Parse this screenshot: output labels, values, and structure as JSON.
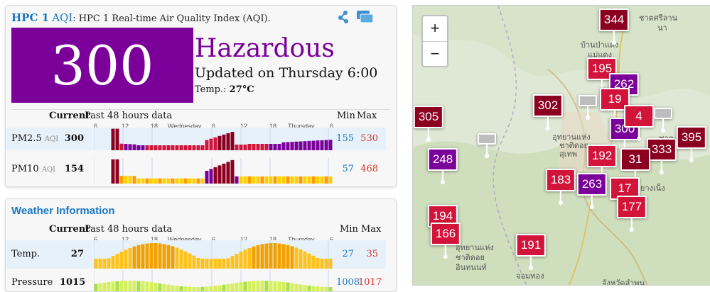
{
  "aqi_panel": {
    "station": "HPC 1",
    "aqi_label": "AQI",
    "subtitle": "HPC 1 Real-time Air Quality Index (AQI).",
    "aqi_value": "300",
    "level": "Hazardous",
    "updated": "Updated on Thursday 6:00",
    "temp_label": "Temp.:",
    "temp_value": "27°C",
    "colors": {
      "hazardous": "#7b0099",
      "very_unhealthy": "#8b0021",
      "unhealthy": "#d2143a",
      "moderate": "#ffd000",
      "sensitive": "#ff9a00"
    },
    "table": {
      "current_header": "Current",
      "history_header": "Past 48 hours data",
      "min_header": "Min",
      "max_header": "Max",
      "axis_ticks": [
        "6",
        "12",
        "18",
        "Wednesday",
        "6",
        "12",
        "18",
        "Thursday",
        "6"
      ],
      "rows": [
        {
          "name": "PM2.5",
          "unit": "AQI",
          "current": "300",
          "min": "155",
          "max": "530"
        },
        {
          "name": "PM10",
          "unit": "AQI",
          "current": "154",
          "min": "57",
          "max": "468"
        }
      ]
    }
  },
  "weather_panel": {
    "title": "Weather Information",
    "current_header": "Current",
    "history_header": "Past 48 hours data",
    "min_header": "Min",
    "max_header": "Max",
    "axis_ticks": [
      "6",
      "12",
      "18",
      "Wednesday",
      "6",
      "12",
      "18",
      "Thursday",
      "6"
    ],
    "rows": [
      {
        "name": "Temp.",
        "current": "27",
        "min": "27",
        "max": "35"
      },
      {
        "name": "Pressure",
        "current": "1015",
        "min": "1008",
        "max": "1017"
      }
    ]
  },
  "map": {
    "zoom_in": "+",
    "zoom_out": "−",
    "labels": [
      "ชาตศรีลาน",
      "นา",
      "บ้านป่าแดง",
      "แม่แดง",
      "อุทยานแห่ง",
      "ชาติดอย",
      "สุเทพ",
      "ยางเน็ง",
      "ชาตะเด็ก",
      "อุทยานแห่ง",
      "ชาติดอย",
      "อินทนนท์",
      "จอมทอง",
      "จังหวัดลำพูน"
    ],
    "markers": [
      {
        "value": "344",
        "level": "very_unhealthy"
      },
      {
        "value": "195",
        "level": "unhealthy"
      },
      {
        "value": "262",
        "level": "hazardous"
      },
      {
        "value": "302",
        "level": "very_unhealthy"
      },
      {
        "value": "305",
        "level": "very_unhealthy"
      },
      {
        "value": "19",
        "level": "unhealthy"
      },
      {
        "value": "300",
        "level": "hazardous"
      },
      {
        "value": "4",
        "level": "unhealthy"
      },
      {
        "value": "333",
        "level": "very_unhealthy"
      },
      {
        "value": "395",
        "level": "very_unhealthy"
      },
      {
        "value": "248",
        "level": "hazardous"
      },
      {
        "value": "192",
        "level": "unhealthy"
      },
      {
        "value": "31",
        "level": "very_unhealthy"
      },
      {
        "value": "183",
        "level": "unhealthy"
      },
      {
        "value": "263",
        "level": "hazardous"
      },
      {
        "value": "17",
        "level": "unhealthy"
      },
      {
        "value": "177",
        "level": "unhealthy"
      },
      {
        "value": "194",
        "level": "unhealthy"
      },
      {
        "value": "166",
        "level": "unhealthy"
      },
      {
        "value": "191",
        "level": "unhealthy"
      },
      {
        "value": "",
        "level": "no_data"
      },
      {
        "value": "",
        "level": "no_data"
      },
      {
        "value": "",
        "level": "no_data"
      }
    ]
  }
}
